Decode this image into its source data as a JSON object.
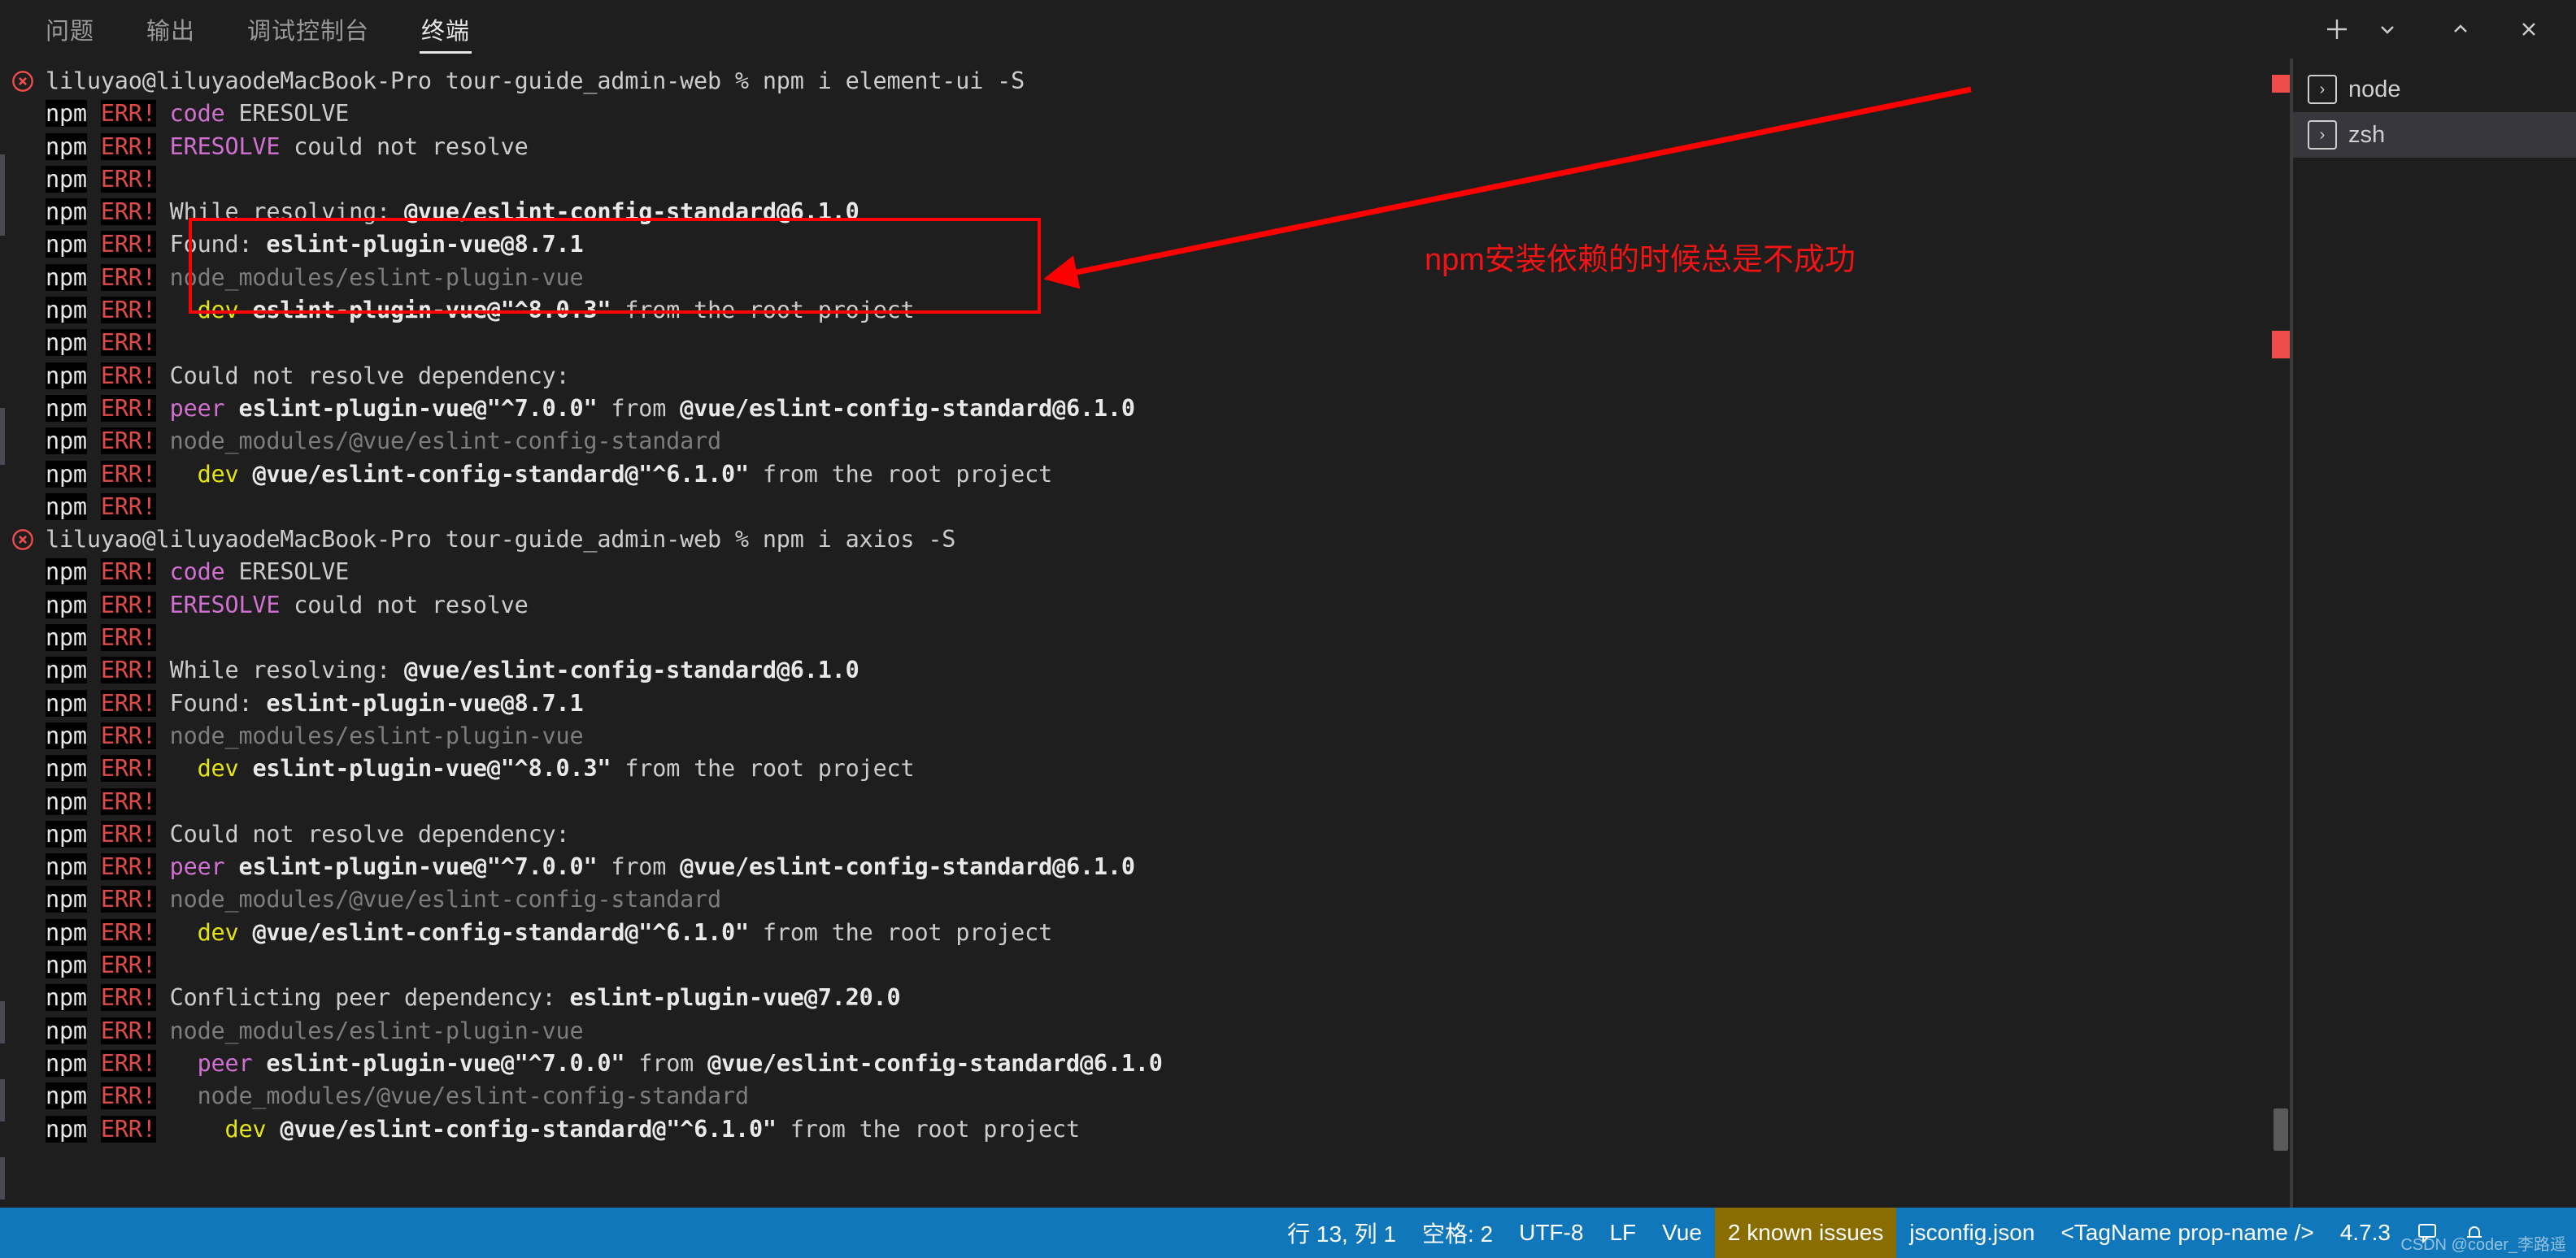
{
  "panel": {
    "tabs": [
      {
        "label": "问题",
        "active": false
      },
      {
        "label": "输出",
        "active": false
      },
      {
        "label": "调试控制台",
        "active": false
      },
      {
        "label": "终端",
        "active": true
      }
    ],
    "actions": [
      {
        "name": "new-terminal-icon",
        "glyph": "+"
      },
      {
        "name": "chevron-down-icon",
        "glyph": "⌄"
      },
      {
        "name": "maximize-panel-icon",
        "glyph": "^"
      },
      {
        "name": "close-panel-icon",
        "glyph": "✕"
      }
    ]
  },
  "terminal": {
    "prompt_user": "liluyao@liluyaodeMacBook-Pro",
    "cwd": "tour-guide_admin-web",
    "prompt_symbol": "%",
    "command_1": "npm i element-ui -S",
    "command_2": "npm i axios -S",
    "prefix_npm": "npm",
    "prefix_err": "ERR!",
    "lines": [
      {
        "type": "prompt",
        "text": "liluyao@liluyaodeMacBook-Pro tour-guide_admin-web % npm i element-ui -S"
      },
      {
        "type": "err",
        "segs": [
          {
            "t": "code ",
            "c": "magenta"
          },
          {
            "t": "ERESOLVE",
            "c": "white"
          }
        ]
      },
      {
        "type": "err",
        "segs": [
          {
            "t": "ERESOLVE",
            "c": "magenta"
          },
          {
            "t": " could not resolve",
            "c": "white"
          }
        ]
      },
      {
        "type": "err",
        "segs": []
      },
      {
        "type": "err",
        "segs": [
          {
            "t": "While resolving: ",
            "c": "white"
          },
          {
            "t": "@vue/eslint-config-standard@6.1.0",
            "c": "bold"
          }
        ]
      },
      {
        "type": "err",
        "segs": [
          {
            "t": "Found: ",
            "c": "white"
          },
          {
            "t": "eslint-plugin-vue@8.7.1",
            "c": "bold"
          }
        ]
      },
      {
        "type": "err",
        "segs": [
          {
            "t": "node_modules/eslint-plugin-vue",
            "c": "dim"
          }
        ]
      },
      {
        "type": "err",
        "segs": [
          {
            "t": "  ",
            "c": "white"
          },
          {
            "t": "dev",
            "c": "yellow"
          },
          {
            "t": " ",
            "c": "white"
          },
          {
            "t": "eslint-plugin-vue@\"^8.0.3\"",
            "c": "bold"
          },
          {
            "t": " from the root project",
            "c": "white"
          }
        ]
      },
      {
        "type": "err",
        "segs": []
      },
      {
        "type": "err",
        "segs": [
          {
            "t": "Could not resolve dependency:",
            "c": "white"
          }
        ]
      },
      {
        "type": "err",
        "segs": [
          {
            "t": "peer",
            "c": "magenta"
          },
          {
            "t": " ",
            "c": "white"
          },
          {
            "t": "eslint-plugin-vue@\"^7.0.0\"",
            "c": "bold"
          },
          {
            "t": " from ",
            "c": "white"
          },
          {
            "t": "@vue/eslint-config-standard@6.1.0",
            "c": "bold"
          }
        ]
      },
      {
        "type": "err",
        "segs": [
          {
            "t": "node_modules/@vue/eslint-config-standard",
            "c": "dim"
          }
        ]
      },
      {
        "type": "err",
        "segs": [
          {
            "t": "  ",
            "c": "white"
          },
          {
            "t": "dev",
            "c": "yellow"
          },
          {
            "t": " ",
            "c": "white"
          },
          {
            "t": "@vue/eslint-config-standard@\"^6.1.0\"",
            "c": "bold"
          },
          {
            "t": " from the root project",
            "c": "white"
          }
        ]
      },
      {
        "type": "err",
        "segs": []
      },
      {
        "type": "prompt",
        "text": "liluyao@liluyaodeMacBook-Pro tour-guide_admin-web % npm i axios -S"
      },
      {
        "type": "err",
        "segs": [
          {
            "t": "code ",
            "c": "magenta"
          },
          {
            "t": "ERESOLVE",
            "c": "white"
          }
        ]
      },
      {
        "type": "err",
        "segs": [
          {
            "t": "ERESOLVE",
            "c": "magenta"
          },
          {
            "t": " could not resolve",
            "c": "white"
          }
        ]
      },
      {
        "type": "err",
        "segs": []
      },
      {
        "type": "err",
        "segs": [
          {
            "t": "While resolving: ",
            "c": "white"
          },
          {
            "t": "@vue/eslint-config-standard@6.1.0",
            "c": "bold"
          }
        ]
      },
      {
        "type": "err",
        "segs": [
          {
            "t": "Found: ",
            "c": "white"
          },
          {
            "t": "eslint-plugin-vue@8.7.1",
            "c": "bold"
          }
        ]
      },
      {
        "type": "err",
        "segs": [
          {
            "t": "node_modules/eslint-plugin-vue",
            "c": "dim"
          }
        ]
      },
      {
        "type": "err",
        "segs": [
          {
            "t": "  ",
            "c": "white"
          },
          {
            "t": "dev",
            "c": "yellow"
          },
          {
            "t": " ",
            "c": "white"
          },
          {
            "t": "eslint-plugin-vue@\"^8.0.3\"",
            "c": "bold"
          },
          {
            "t": " from the root project",
            "c": "white"
          }
        ]
      },
      {
        "type": "err",
        "segs": []
      },
      {
        "type": "err",
        "segs": [
          {
            "t": "Could not resolve dependency:",
            "c": "white"
          }
        ]
      },
      {
        "type": "err",
        "segs": [
          {
            "t": "peer",
            "c": "magenta"
          },
          {
            "t": " ",
            "c": "white"
          },
          {
            "t": "eslint-plugin-vue@\"^7.0.0\"",
            "c": "bold"
          },
          {
            "t": " from ",
            "c": "white"
          },
          {
            "t": "@vue/eslint-config-standard@6.1.0",
            "c": "bold"
          }
        ]
      },
      {
        "type": "err",
        "segs": [
          {
            "t": "node_modules/@vue/eslint-config-standard",
            "c": "dim"
          }
        ]
      },
      {
        "type": "err",
        "segs": [
          {
            "t": "  ",
            "c": "white"
          },
          {
            "t": "dev",
            "c": "yellow"
          },
          {
            "t": " ",
            "c": "white"
          },
          {
            "t": "@vue/eslint-config-standard@\"^6.1.0\"",
            "c": "bold"
          },
          {
            "t": " from the root project",
            "c": "white"
          }
        ]
      },
      {
        "type": "err",
        "segs": []
      },
      {
        "type": "err",
        "segs": [
          {
            "t": "Conflicting peer dependency: ",
            "c": "white"
          },
          {
            "t": "eslint-plugin-vue@7.20.0",
            "c": "bold"
          }
        ]
      },
      {
        "type": "err",
        "segs": [
          {
            "t": "node_modules/eslint-plugin-vue",
            "c": "dim"
          }
        ]
      },
      {
        "type": "err",
        "segs": [
          {
            "t": "  ",
            "c": "white"
          },
          {
            "t": "peer",
            "c": "magenta"
          },
          {
            "t": " ",
            "c": "white"
          },
          {
            "t": "eslint-plugin-vue@\"^7.0.0\"",
            "c": "bold"
          },
          {
            "t": " from ",
            "c": "white"
          },
          {
            "t": "@vue/eslint-config-standard@6.1.0",
            "c": "bold"
          }
        ]
      },
      {
        "type": "err",
        "segs": [
          {
            "t": "  node_modules/@vue/eslint-config-standard",
            "c": "dim"
          }
        ]
      },
      {
        "type": "err",
        "segs": [
          {
            "t": "    ",
            "c": "white"
          },
          {
            "t": "dev",
            "c": "yellow"
          },
          {
            "t": " ",
            "c": "white"
          },
          {
            "t": "@vue/eslint-config-standard@\"^6.1.0\"",
            "c": "bold"
          },
          {
            "t": " from the root project",
            "c": "white"
          }
        ]
      }
    ]
  },
  "terminal_list": {
    "items": [
      {
        "label": "node",
        "icon": "terminal-icon",
        "selected": false
      },
      {
        "label": "zsh",
        "icon": "terminal-icon",
        "selected": true
      }
    ]
  },
  "annotation": {
    "text": "npm安装依赖的时候总是不成功",
    "color": "#f01414"
  },
  "statusbar": {
    "items": [
      {
        "name": "cursor-position",
        "label": "行 13, 列 1",
        "warn": false
      },
      {
        "name": "indentation",
        "label": "空格: 2",
        "warn": false
      },
      {
        "name": "encoding",
        "label": "UTF-8",
        "warn": false
      },
      {
        "name": "eol",
        "label": "LF",
        "warn": false
      },
      {
        "name": "language-mode",
        "label": "Vue",
        "warn": false
      },
      {
        "name": "known-issues",
        "label": "2 known issues",
        "warn": true
      },
      {
        "name": "jsconfig",
        "label": "jsconfig.json",
        "warn": false
      },
      {
        "name": "tag-hint",
        "label": "<TagName prop-name />",
        "warn": false
      },
      {
        "name": "version",
        "label": "4.7.3",
        "warn": false
      }
    ],
    "background": "#1177bb",
    "warn_background": "#8a6d00",
    "watermark": "CSDN @coder_李路遥"
  }
}
